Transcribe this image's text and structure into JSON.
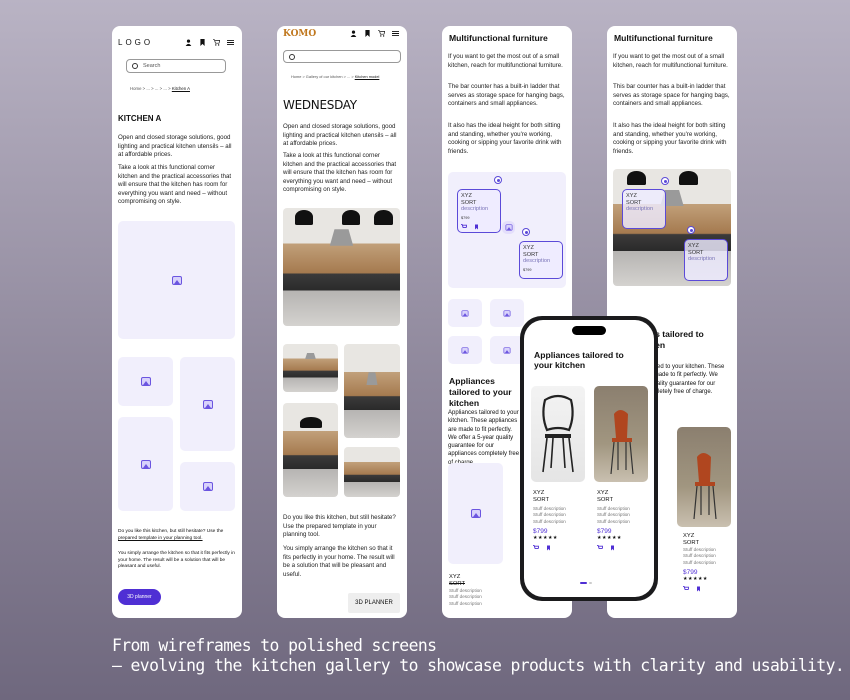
{
  "panel1": {
    "logo": "LOGO",
    "search_placeholder": "Search",
    "breadcrumb_prefix": "Home  >  ...  >  ...  >  ...  >",
    "breadcrumb_current": "Kitchen A",
    "title": "KITCHEN A",
    "p1": "Open and closed storage solutions, good lighting and practical kitchen utensils – all at affordable prices.",
    "p2": "Take a look at this functional corner kitchen and the practical accessories that will ensure that the kitchen has room for everything you want and need – without compromising on style.",
    "footer_p1": "Do you like this kitchen, but still hesitate? Use the",
    "footer_link": "prepared template in your planning tool.",
    "footer_p2": "You simply arrange the kitchen so that it fits perfectly in your home. The result will be a solution that will be pleasant and useful.",
    "button": "3D planner"
  },
  "panel2": {
    "logo": "KOMO",
    "breadcrumb_prefix": "Home  >  Gallery of our kitchen  >  ...  >",
    "breadcrumb_current": "Kitchen model",
    "title": "WEDNESDAY",
    "p1": "Open and closed storage solutions, good lighting and practical kitchen utensils – all at affordable prices.",
    "p2": "Take a look at this functional corner kitchen and the practical accessories that will ensure that the kitchen has room for everything you want and need – without compromising on style.",
    "footer_p1": "Do you like this kitchen, but still hesitate? Use the prepared template in your planning tool.",
    "footer_p2": "You simply arrange the kitchen so that it fits perfectly in your home. The result will be a solution that will be pleasant and useful.",
    "button": "3D PLANNER"
  },
  "panel3": {
    "title": "Multifunctional furniture",
    "p1": "If you want to get the most out of a small kitchen, reach for multifunctional furniture.",
    "p2": "The bar counter has a built-in ladder that serves as storage space for hanging bags, containers and small appliances.",
    "p3": "It also has the ideal height for both sitting and standing, whether you're working, cooking or sipping your favorite drink with friends.",
    "tag_name": "XYZ",
    "tag_sort": "SORT",
    "tag_desc": "description",
    "tag_price": "$799",
    "h2": "Appliances tailored to your kitchen",
    "p4": "Appliances tailored to your kitchen. These appliances are made to fit perfectly. We offer a 5-year quality guarantee for our appliances completely free of charge.",
    "card_name": "XYZ",
    "card_sort": "SORT",
    "card_desc": "Stuff description"
  },
  "panel4": {
    "title": "Multifunctional furniture",
    "p1": "If you want to get the most out of a small kitchen, reach for multifunctional furniture.",
    "p2": "This bar counter has a built-in ladder that serves as storage space for hanging bags, containers and small appliances.",
    "p3": "It also has the ideal height for both sitting and standing, whether you're working, cooking or sipping your favorite drink with friends.",
    "tag_name": "XYZ",
    "tag_sort": "SORT",
    "tag_desc": "description",
    "h2": "Appliances tailored to your kitchen",
    "p4": "Appliances tailored to your kitchen. These appliances are made to fit perfectly. We offer a 5-year quality guarantee for our appliances completely free of charge.",
    "card_name": "XYZ",
    "card_sort": "SORT",
    "card_desc": "Stuff description",
    "card_price": "$799",
    "card_stars": "★★★★★"
  },
  "phone": {
    "heading": "Appliances tailored to your kitchen",
    "products": [
      {
        "name": "XYZ",
        "sort": "SORT",
        "desc": "Stuff description",
        "price": "$799",
        "stars": "★★★★★"
      },
      {
        "name": "XYZ",
        "sort": "SORT",
        "desc": "Stuff description",
        "price": "$799",
        "stars": "★★★★★"
      }
    ]
  },
  "caption": {
    "line1": "From wireframes to polished screens",
    "line2": "— evolving the kitchen gallery to showcase products with clarity and usability."
  },
  "colors": {
    "accent": "#4f2fd4",
    "placeholder": "#f1effc"
  }
}
